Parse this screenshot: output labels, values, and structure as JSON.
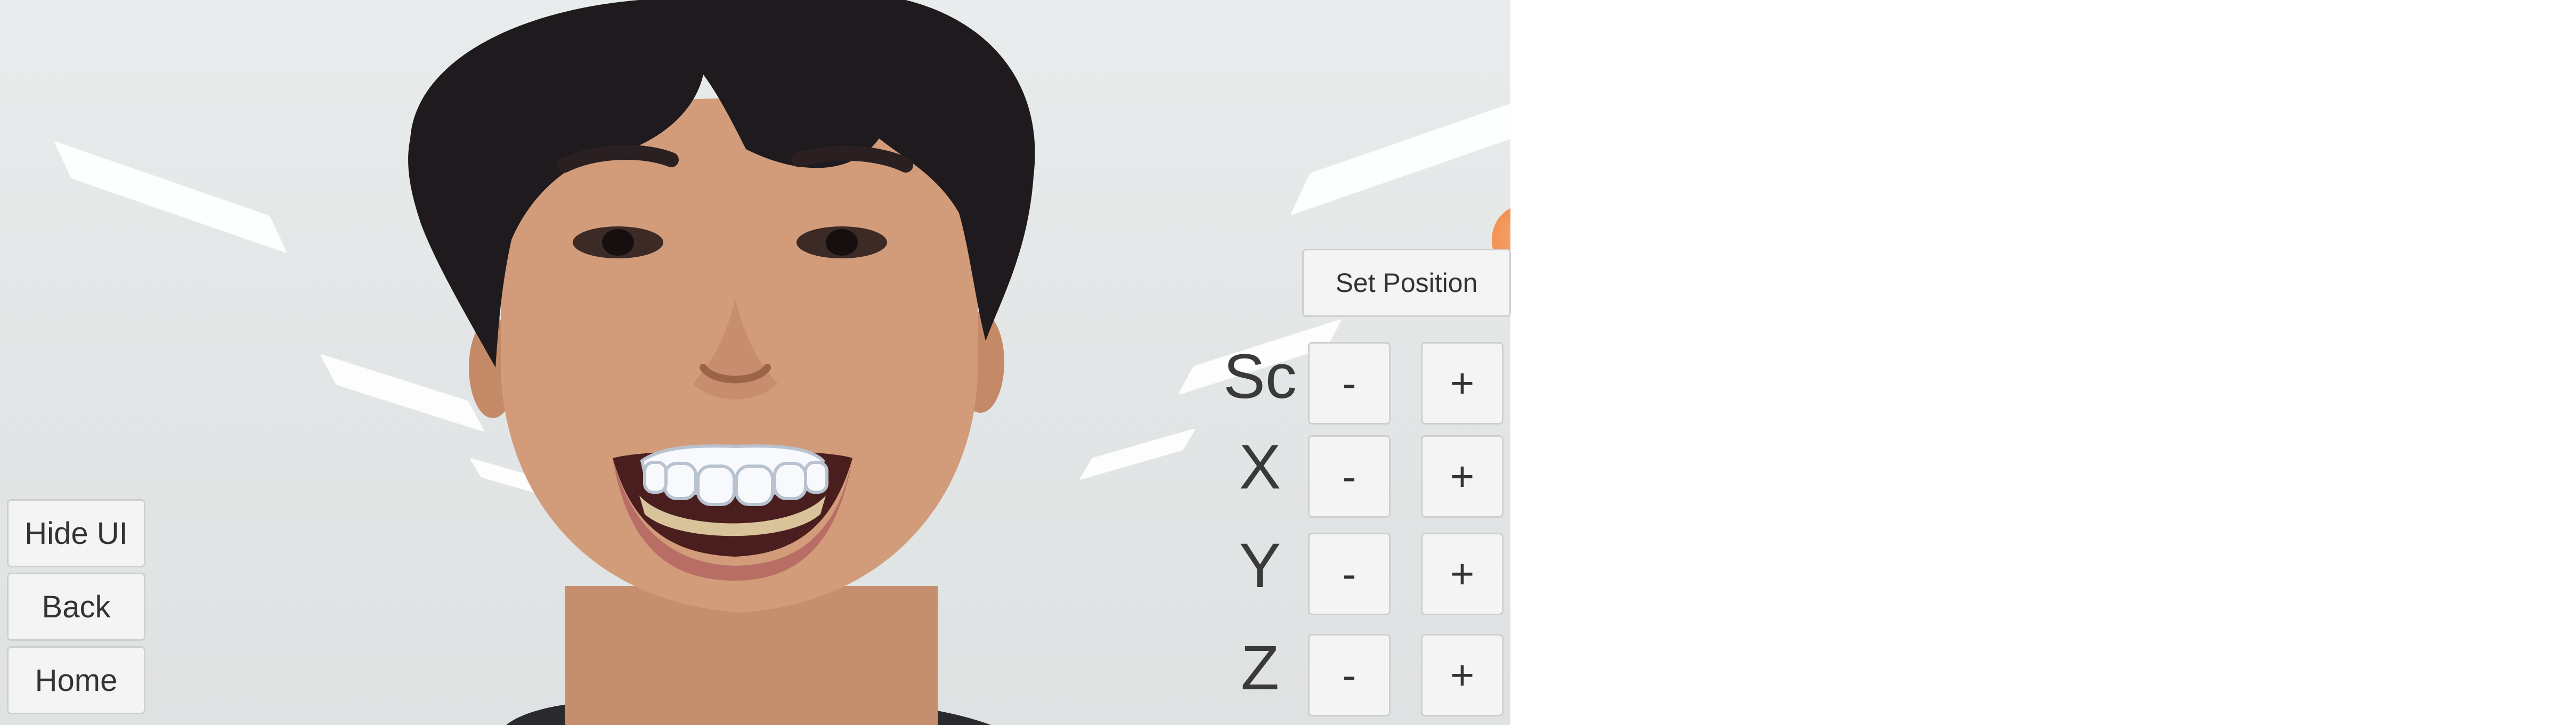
{
  "left_controls": {
    "hide_ui": "Hide UI",
    "back": "Back",
    "home": "Home"
  },
  "set_position": "Set Position",
  "adjust": {
    "scale": {
      "label": "Sc",
      "minus": "-",
      "plus": "+"
    },
    "x": {
      "label": "X",
      "minus": "-",
      "plus": "+"
    },
    "y": {
      "label": "Y",
      "minus": "-",
      "plus": "+"
    },
    "z": {
      "label": "Z",
      "minus": "-",
      "plus": "+"
    }
  },
  "colors": {
    "button_bg": "#f4f4f4",
    "button_border": "#cfcfcf",
    "text": "#333333",
    "indicator": "#f08a4b"
  },
  "icons": {
    "indicator": "orange-dot-icon"
  }
}
